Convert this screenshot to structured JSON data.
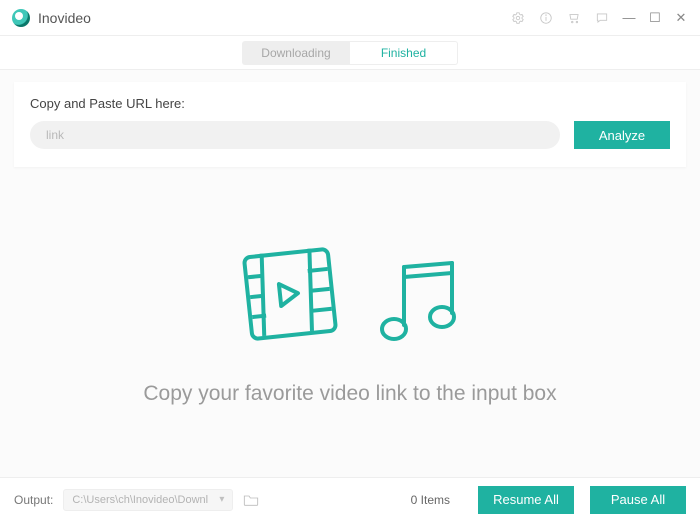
{
  "app": {
    "title": "Inovideo"
  },
  "tabs": {
    "downloading": "Downloading",
    "finished": "Finished"
  },
  "url": {
    "label": "Copy and Paste URL here:",
    "placeholder": "link",
    "analyze": "Analyze"
  },
  "empty": {
    "message": "Copy your favorite video link to the input box"
  },
  "footer": {
    "output_label": "Output:",
    "output_path": "C:\\Users\\ch\\Inovideo\\Downl",
    "items_count": "0 Items",
    "resume": "Resume All",
    "pause": "Pause All"
  },
  "colors": {
    "accent": "#1fb2a1"
  }
}
